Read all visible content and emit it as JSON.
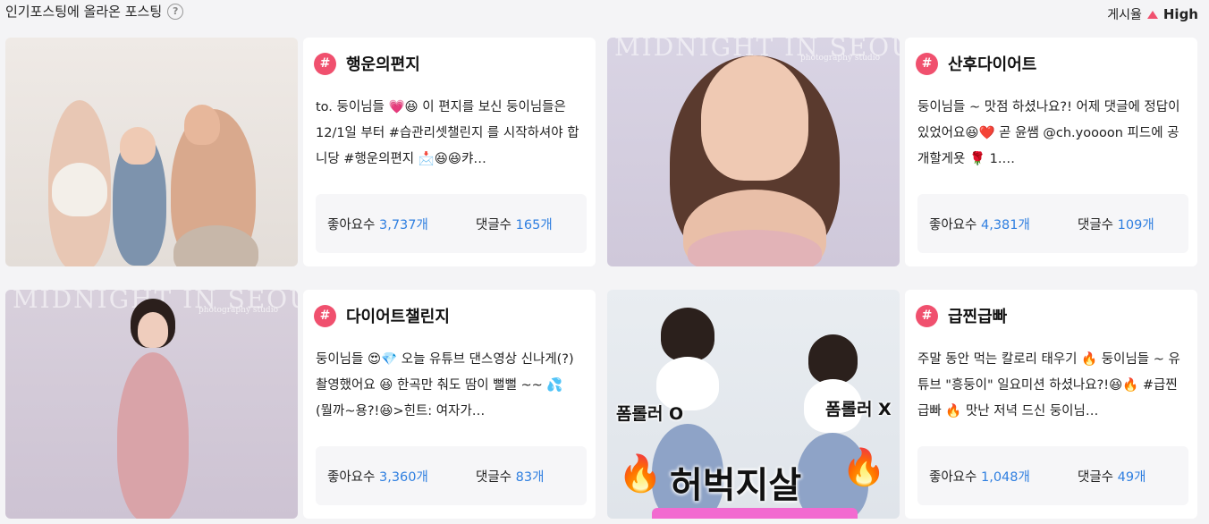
{
  "header": {
    "title": "인기포스팅에 올라온 포스팅",
    "help_icon": "?",
    "rate_label": "게시율",
    "rate_level": "High"
  },
  "colors": {
    "accent": "#f0506e",
    "number": "#2f7fe0"
  },
  "posts": [
    {
      "tag": "행운의편지",
      "description": "to. 둥이님들 💗😆 이 편지를 보신 둥이님들은 12/1일 부터 #습관리셋챌린지 를 시작하셔야 합니당 #행운의편지 📩😆😆캬…",
      "likes_label": "좋아요수",
      "likes": "3,737개",
      "comments_label": "댓글수",
      "comments": "165개"
    },
    {
      "tag": "산후다이어트",
      "description": "둥이님들 ~ 맛점 하셨나요?! 어제 댓글에 정답이 있었어요😆❤️ 곧 윤쌤 @ch.yoooon 피드에 공개할게욧 🌹 1.…",
      "likes_label": "좋아요수",
      "likes": "4,381개",
      "comments_label": "댓글수",
      "comments": "109개"
    },
    {
      "tag": "다이어트챌린지",
      "description": "둥이님들 😍💎 오늘 유튜브 댄스영상 신나게(?) 촬영했어요 😆 한곡만 춰도 땀이 뻘뻘 ~~ 💦 (뭘까~용?!😆>힌트: 여자가…",
      "likes_label": "좋아요수",
      "likes": "3,360개",
      "comments_label": "댓글수",
      "comments": "83개"
    },
    {
      "tag": "급찐급빠",
      "description": "주말 동안 먹는 칼로리 태우기 🔥 둥이님들 ~ 유튜브 \"흥둥이\" 일요미션 하셨나요?!😆🔥 #급찐급빠 🔥 맛난 저녁 드신 둥이님…",
      "likes_label": "좋아요수",
      "likes": "1,048개",
      "comments_label": "댓글수",
      "comments": "49개"
    }
  ],
  "thumbnails": {
    "watermark": "MIDNIGHT IN SEOUL",
    "watermark_sub": "photography studio",
    "video_left_label": "폼롤러 O",
    "video_right_label": "폼롤러 X",
    "video_title": "허벅지살",
    "fire_icon": "🔥"
  }
}
